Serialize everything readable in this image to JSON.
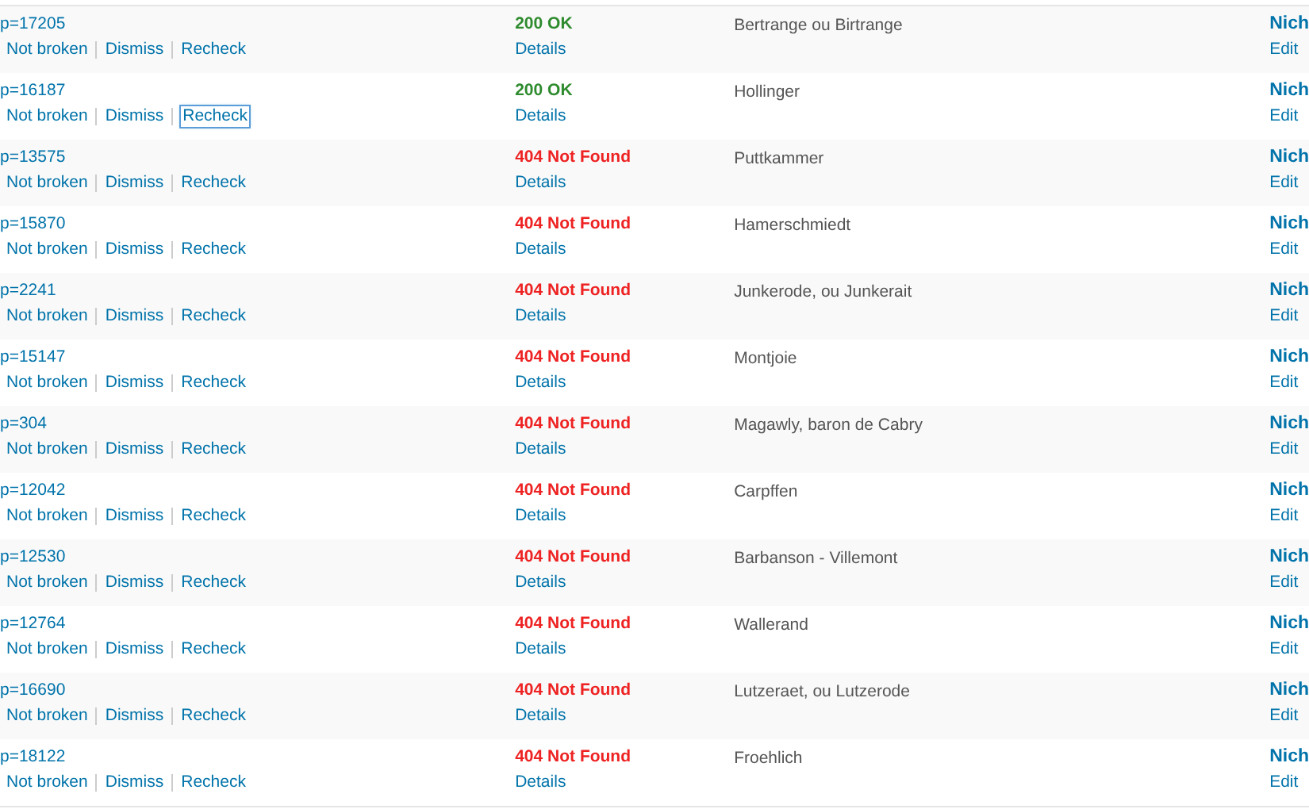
{
  "rows": [
    {
      "url": "p=17205",
      "actions": [
        {
          "label": "Not broken",
          "focused": false
        },
        {
          "label": "Dismiss",
          "focused": false
        },
        {
          "label": "Recheck",
          "focused": false
        }
      ],
      "status": {
        "kind": "ok",
        "text": "200 OK"
      },
      "details": "Details",
      "link_text": "Bertrange ou Birtrange",
      "source": "Nich",
      "edit": "Edit"
    },
    {
      "url": "p=16187",
      "actions": [
        {
          "label": "Not broken",
          "focused": false
        },
        {
          "label": "Dismiss",
          "focused": false
        },
        {
          "label": "Recheck",
          "focused": true
        }
      ],
      "status": {
        "kind": "ok",
        "text": "200 OK"
      },
      "details": "Details",
      "link_text": "Hollinger",
      "source": "Nich",
      "edit": "Edit"
    },
    {
      "url": "p=13575",
      "actions": [
        {
          "label": "Not broken",
          "focused": false
        },
        {
          "label": "Dismiss",
          "focused": false
        },
        {
          "label": "Recheck",
          "focused": false
        }
      ],
      "status": {
        "kind": "error",
        "text": "404 Not Found"
      },
      "details": "Details",
      "link_text": "Puttkammer",
      "source": "Nich",
      "edit": "Edit"
    },
    {
      "url": "p=15870",
      "actions": [
        {
          "label": "Not broken",
          "focused": false
        },
        {
          "label": "Dismiss",
          "focused": false
        },
        {
          "label": "Recheck",
          "focused": false
        }
      ],
      "status": {
        "kind": "error",
        "text": "404 Not Found"
      },
      "details": "Details",
      "link_text": "Hamerschmiedt",
      "source": "Nich",
      "edit": "Edit"
    },
    {
      "url": "p=2241",
      "actions": [
        {
          "label": "Not broken",
          "focused": false
        },
        {
          "label": "Dismiss",
          "focused": false
        },
        {
          "label": "Recheck",
          "focused": false
        }
      ],
      "status": {
        "kind": "error",
        "text": "404 Not Found"
      },
      "details": "Details",
      "link_text": "Junkerode, ou Junkerait",
      "source": "Nich",
      "edit": "Edit"
    },
    {
      "url": "p=15147",
      "actions": [
        {
          "label": "Not broken",
          "focused": false
        },
        {
          "label": "Dismiss",
          "focused": false
        },
        {
          "label": "Recheck",
          "focused": false
        }
      ],
      "status": {
        "kind": "error",
        "text": "404 Not Found"
      },
      "details": "Details",
      "link_text": "Montjoie",
      "source": "Nich",
      "edit": "Edit"
    },
    {
      "url": "p=304",
      "actions": [
        {
          "label": "Not broken",
          "focused": false
        },
        {
          "label": "Dismiss",
          "focused": false
        },
        {
          "label": "Recheck",
          "focused": false
        }
      ],
      "status": {
        "kind": "error",
        "text": "404 Not Found"
      },
      "details": "Details",
      "link_text": "Magawly, baron de Cabry",
      "source": "Nich",
      "edit": "Edit"
    },
    {
      "url": "p=12042",
      "actions": [
        {
          "label": "Not broken",
          "focused": false
        },
        {
          "label": "Dismiss",
          "focused": false
        },
        {
          "label": "Recheck",
          "focused": false
        }
      ],
      "status": {
        "kind": "error",
        "text": "404 Not Found"
      },
      "details": "Details",
      "link_text": "Carpffen",
      "source": "Nich",
      "edit": "Edit"
    },
    {
      "url": "p=12530",
      "actions": [
        {
          "label": "Not broken",
          "focused": false
        },
        {
          "label": "Dismiss",
          "focused": false
        },
        {
          "label": "Recheck",
          "focused": false
        }
      ],
      "status": {
        "kind": "error",
        "text": "404 Not Found"
      },
      "details": "Details",
      "link_text": "Barbanson - Villemont",
      "source": "Nich",
      "edit": "Edit"
    },
    {
      "url": "p=12764",
      "actions": [
        {
          "label": "Not broken",
          "focused": false
        },
        {
          "label": "Dismiss",
          "focused": false
        },
        {
          "label": "Recheck",
          "focused": false
        }
      ],
      "status": {
        "kind": "error",
        "text": "404 Not Found"
      },
      "details": "Details",
      "link_text": "Wallerand",
      "source": "Nich",
      "edit": "Edit"
    },
    {
      "url": "p=16690",
      "actions": [
        {
          "label": "Not broken",
          "focused": false
        },
        {
          "label": "Dismiss",
          "focused": false
        },
        {
          "label": "Recheck",
          "focused": false
        }
      ],
      "status": {
        "kind": "error",
        "text": "404 Not Found"
      },
      "details": "Details",
      "link_text": "Lutzeraet, ou Lutzerode",
      "source": "Nich",
      "edit": "Edit"
    },
    {
      "url": "p=18122",
      "actions": [
        {
          "label": "Not broken",
          "focused": false
        },
        {
          "label": "Dismiss",
          "focused": false
        },
        {
          "label": "Recheck",
          "focused": false
        }
      ],
      "status": {
        "kind": "error",
        "text": "404 Not Found"
      },
      "details": "Details",
      "link_text": "Froehlich",
      "source": "Nich",
      "edit": "Edit"
    }
  ]
}
